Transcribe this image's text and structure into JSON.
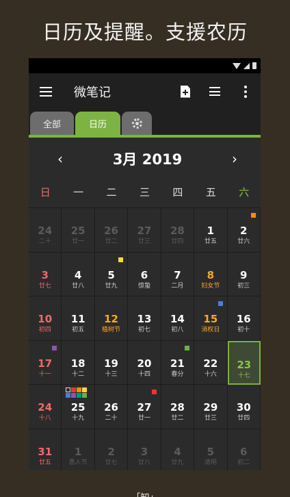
{
  "banner": "日历及提醒。支援农历",
  "app": {
    "title": "微笔记"
  },
  "icons": {
    "new_note": "add-note-icon",
    "list": "list-view-icon",
    "more": "more-icon",
    "menu": "menu-icon",
    "settings": "gear-icon"
  },
  "tabs": {
    "all": "全部",
    "calendar": "日历"
  },
  "nav": {
    "prev": "‹",
    "next": "›",
    "month": "3月 2019"
  },
  "weekdays": [
    "日",
    "一",
    "二",
    "三",
    "四",
    "五",
    "六"
  ],
  "colors": {
    "accent": "#7cb342",
    "sunday": "#f06a6a",
    "holiday": "#ffa726",
    "today_bg": "#3e4a33"
  },
  "days": [
    {
      "d": "24",
      "l": "二十",
      "t": "other"
    },
    {
      "d": "25",
      "l": "廿一",
      "t": "other"
    },
    {
      "d": "26",
      "l": "廿二",
      "t": "other"
    },
    {
      "d": "27",
      "l": "廿三",
      "t": "other"
    },
    {
      "d": "28",
      "l": "廿四",
      "t": "other"
    },
    {
      "d": "1",
      "l": "廿五",
      "t": ""
    },
    {
      "d": "2",
      "l": "廿六",
      "t": "",
      "mark": "#ff8c00"
    },
    {
      "d": "3",
      "l": "廿七",
      "t": "sun"
    },
    {
      "d": "4",
      "l": "廿八",
      "t": ""
    },
    {
      "d": "5",
      "l": "廿九",
      "t": "",
      "mark": "#ffd740"
    },
    {
      "d": "6",
      "l": "惊蛰",
      "t": ""
    },
    {
      "d": "7",
      "l": "二月",
      "t": ""
    },
    {
      "d": "8",
      "l": "妇女节",
      "t": "holiday"
    },
    {
      "d": "9",
      "l": "初三",
      "t": ""
    },
    {
      "d": "10",
      "l": "初四",
      "t": "sun"
    },
    {
      "d": "11",
      "l": "初五",
      "t": ""
    },
    {
      "d": "12",
      "l": "植树节",
      "t": "holiday"
    },
    {
      "d": "13",
      "l": "初七",
      "t": ""
    },
    {
      "d": "14",
      "l": "初八",
      "t": ""
    },
    {
      "d": "15",
      "l": "消权日",
      "t": "holiday",
      "mark": "#4a7fd4"
    },
    {
      "d": "16",
      "l": "初十",
      "t": ""
    },
    {
      "d": "17",
      "l": "十一",
      "t": "sun",
      "mark": "#8e55b0"
    },
    {
      "d": "18",
      "l": "十二",
      "t": ""
    },
    {
      "d": "19",
      "l": "十三",
      "t": ""
    },
    {
      "d": "20",
      "l": "十四",
      "t": ""
    },
    {
      "d": "21",
      "l": "春分",
      "t": "",
      "mark": "#6ab04c"
    },
    {
      "d": "22",
      "l": "十六",
      "t": ""
    },
    {
      "d": "23",
      "l": "十七",
      "t": "today"
    },
    {
      "d": "24",
      "l": "十八",
      "t": "sun"
    },
    {
      "d": "25",
      "l": "十九",
      "t": "",
      "marks": [
        "#2b2b2b",
        "#e53935",
        "#ff8c00",
        "#ffd740",
        "#4a7fd4",
        "#8e55b0",
        "#009688",
        "#6ab04c"
      ]
    },
    {
      "d": "26",
      "l": "二十",
      "t": ""
    },
    {
      "d": "27",
      "l": "廿一",
      "t": "",
      "mark": "#e53935"
    },
    {
      "d": "28",
      "l": "廿二",
      "t": ""
    },
    {
      "d": "29",
      "l": "廿三",
      "t": ""
    },
    {
      "d": "30",
      "l": "廿四",
      "t": ""
    },
    {
      "d": "31",
      "l": "廿五",
      "t": "sun"
    },
    {
      "d": "1",
      "l": "愚人节",
      "t": "other"
    },
    {
      "d": "2",
      "l": "廿七",
      "t": "other"
    },
    {
      "d": "3",
      "l": "廿八",
      "t": "other"
    },
    {
      "d": "4",
      "l": "廿九",
      "t": "other"
    },
    {
      "d": "5",
      "l": "清明",
      "t": "other"
    },
    {
      "d": "6",
      "l": "初二",
      "t": "other"
    }
  ],
  "footer": "「知」"
}
